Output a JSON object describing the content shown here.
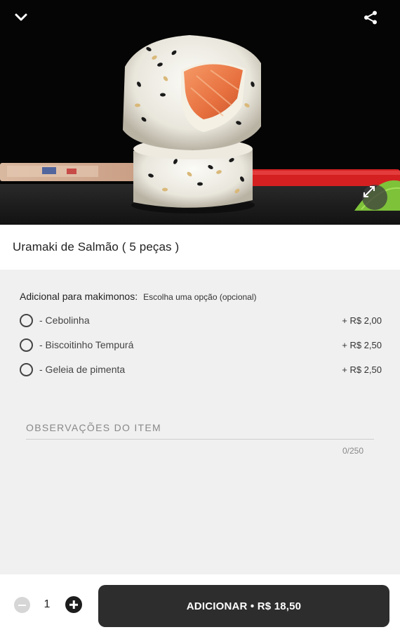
{
  "product": {
    "title": "Uramaki de Salmão ( 5 peças )"
  },
  "icons": {
    "back": "chevron-down-icon",
    "share": "share-icon",
    "expand": "expand-icon"
  },
  "addon_group": {
    "title": "Adicional para makimonos:",
    "hint": "Escolha uma opção (opcional)",
    "options": [
      {
        "label": "- Cebolinha",
        "price": "+ R$ 2,00",
        "selected": false
      },
      {
        "label": "- Biscoitinho Tempurá",
        "price": "+ R$ 2,50",
        "selected": false
      },
      {
        "label": "- Geleia de pimenta",
        "price": "+ R$ 2,50",
        "selected": false
      }
    ]
  },
  "observations": {
    "label": "OBSERVAÇÕES DO ITEM",
    "value": "",
    "counter": "0/250"
  },
  "order": {
    "quantity": "1",
    "add_label": "ADICIONAR • R$ 18,50"
  },
  "colors": {
    "button_background": "#2d2d2d",
    "page_background": "#f0f0f0"
  }
}
